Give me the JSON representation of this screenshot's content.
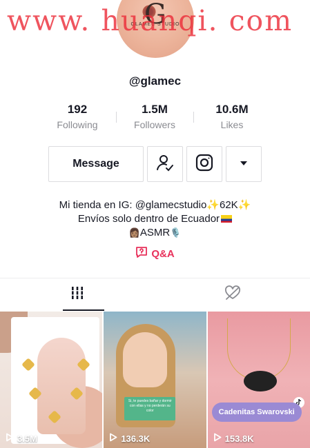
{
  "watermark": {
    "text": "www. huanqi. com"
  },
  "profile": {
    "avatar_text": "G",
    "avatar_caption": "GLAMEC STUDIO",
    "username": "@glamec"
  },
  "stats": [
    {
      "value": "192",
      "label": "Following"
    },
    {
      "value": "1.5M",
      "label": "Followers"
    },
    {
      "value": "10.6M",
      "label": "Likes"
    }
  ],
  "actions": {
    "message_label": "Message",
    "follow_icon": "user-check-icon",
    "instagram_icon": "instagram-icon",
    "more_icon": "triangle-down-icon"
  },
  "bio": {
    "line1": "Mi tienda en IG: @glamecstudio✨62K✨",
    "line2": "Envíos solo dentro de Ecuador",
    "line3_prefix": "👩🏽",
    "line3_text": "ASMR",
    "line3_suffix": "🎙️",
    "qa_label": "Q&A"
  },
  "tabs": [
    {
      "icon": "grid-icon",
      "active": true
    },
    {
      "icon": "liked-videos-icon",
      "active": false
    }
  ],
  "videos": [
    {
      "views": "3.5M"
    },
    {
      "views": "136.3K",
      "overlay_text": "Si, te puedes bañar y dormir con ellas y no perderán su color"
    },
    {
      "views": "153.8K",
      "pill_text": "Cadenitas Swarovski"
    }
  ],
  "colors": {
    "accent": "#e8315b",
    "watermark": "#ec2e3a",
    "text": "#161823",
    "muted": "#8a8b91"
  }
}
